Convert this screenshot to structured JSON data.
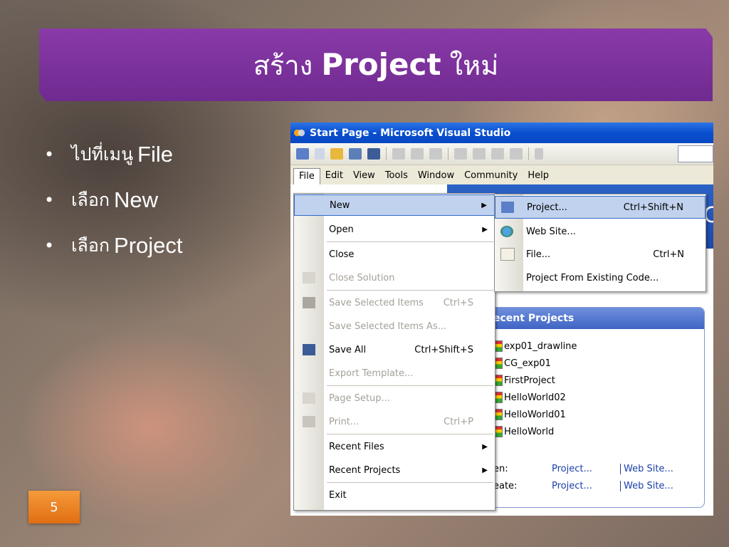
{
  "slide": {
    "title_th": "สร้าง",
    "title_en": "Project",
    "title_th2": "ใหม่",
    "bullets": [
      {
        "th": "ไปที่เมนู",
        "en": "File"
      },
      {
        "th": "เลือก",
        "en": "New"
      },
      {
        "th": "เลือก",
        "en": "Project"
      }
    ],
    "page_number": "5",
    "colors": {
      "banner": "#7a2f9b",
      "page_badge": "#f0821e"
    }
  },
  "window": {
    "title": "Start Page - Microsoft Visual Studio",
    "menubar": {
      "file": "File",
      "edit": "Edit",
      "view": "View",
      "tools": "Tools",
      "window": "Window",
      "community": "Community",
      "help": "Help"
    },
    "strip_letter": "C"
  },
  "file_menu": {
    "new": "New",
    "open": "Open",
    "close": "Close",
    "close_solution": "Close Solution",
    "save_selected": "Save Selected Items",
    "save_selected_sc": "Ctrl+S",
    "save_selected_as": "Save Selected Items As...",
    "save_all": "Save All",
    "save_all_sc": "Ctrl+Shift+S",
    "export_template": "Export Template...",
    "page_setup": "Page Setup...",
    "print": "Print...",
    "print_sc": "Ctrl+P",
    "recent_files": "Recent Files",
    "recent_projects": "Recent Projects",
    "exit": "Exit"
  },
  "new_submenu": {
    "project": "Project...",
    "project_sc": "Ctrl+Shift+N",
    "website": "Web Site...",
    "file": "File...",
    "file_sc": "Ctrl+N",
    "from_existing": "Project From Existing Code..."
  },
  "recent_panel": {
    "header": "ecent Projects",
    "projects": [
      "exp01_drawline",
      "CG_exp01",
      "FirstProject",
      "HelloWorld02",
      "HelloWorld01",
      "HelloWorld"
    ],
    "open_label": "en:",
    "create_label": "eate:",
    "project_link": "Project...",
    "website_link": "Web Site..."
  }
}
